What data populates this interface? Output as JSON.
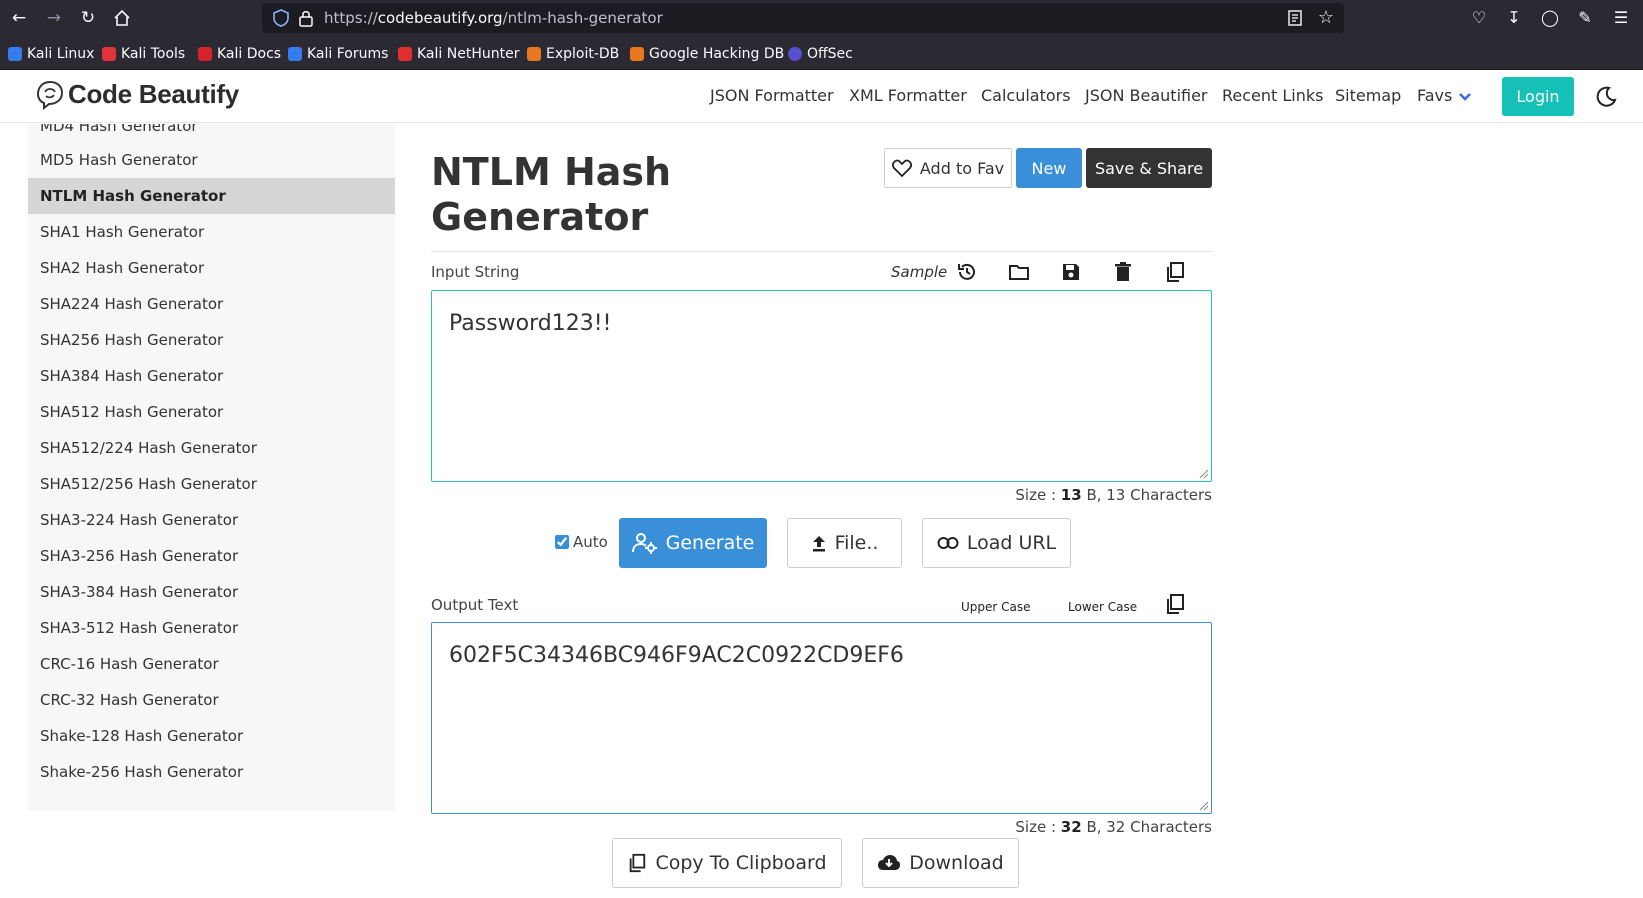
{
  "browser": {
    "url_scheme": "https://",
    "url_host": "codebeautify.org",
    "url_path": "/ntlm-hash-generator",
    "bookmarks": [
      {
        "label": "Kali Linux",
        "color": "#367bf0"
      },
      {
        "label": "Kali Tools",
        "color": "#e0333a"
      },
      {
        "label": "Kali Docs",
        "color": "#d6232b"
      },
      {
        "label": "Kali Forums",
        "color": "#367bf0"
      },
      {
        "label": "Kali NetHunter",
        "color": "#e03030"
      },
      {
        "label": "Exploit-DB",
        "color": "#e8781f"
      },
      {
        "label": "Google Hacking DB",
        "color": "#e8781f"
      },
      {
        "label": "OffSec",
        "color": "#5a4fcf"
      }
    ]
  },
  "header": {
    "logo_text": "Code Beautify",
    "nav": [
      "JSON Formatter",
      "XML Formatter",
      "Calculators",
      "JSON Beautifier",
      "Recent Links",
      "Sitemap",
      "Favs"
    ],
    "login_label": "Login",
    "accent_color": "#15c1b6"
  },
  "sidebar": {
    "items": [
      "MD4 Hash Generator",
      "MD5 Hash Generator",
      "NTLM Hash Generator",
      "SHA1 Hash Generator",
      "SHA2 Hash Generator",
      "SHA224 Hash Generator",
      "SHA256 Hash Generator",
      "SHA384 Hash Generator",
      "SHA512 Hash Generator",
      "SHA512/224 Hash Generator",
      "SHA512/256 Hash Generator",
      "SHA3-224 Hash Generator",
      "SHA3-256 Hash Generator",
      "SHA3-384 Hash Generator",
      "SHA3-512 Hash Generator",
      "CRC-16 Hash Generator",
      "CRC-32 Hash Generator",
      "Shake-128 Hash Generator",
      "Shake-256 Hash Generator"
    ],
    "active": "NTLM Hash Generator"
  },
  "main": {
    "title": "NTLM Hash Generator",
    "add_fav_label": "Add to Fav",
    "new_label": "New",
    "save_share_label": "Save & Share",
    "input": {
      "label": "Input String",
      "sample_label": "Sample",
      "value": "Password123!!",
      "size_prefix": "Size : ",
      "size_bytes": "13",
      "size_suffix": " B, 13 Characters"
    },
    "auto_label": "Auto",
    "auto_checked": true,
    "generate_label": "Generate",
    "file_label": "File..",
    "load_url_label": "Load URL",
    "output": {
      "label": "Output Text",
      "upper_case_label": "Upper Case",
      "lower_case_label": "Lower Case",
      "value": "602F5C34346BC946F9AC2C0922CD9EF6",
      "size_prefix": "Size : ",
      "size_bytes": "32",
      "size_suffix": " B, 32 Characters"
    },
    "copy_label": "Copy To Clipboard",
    "download_label": "Download",
    "primary_color": "#3a8fd9"
  }
}
